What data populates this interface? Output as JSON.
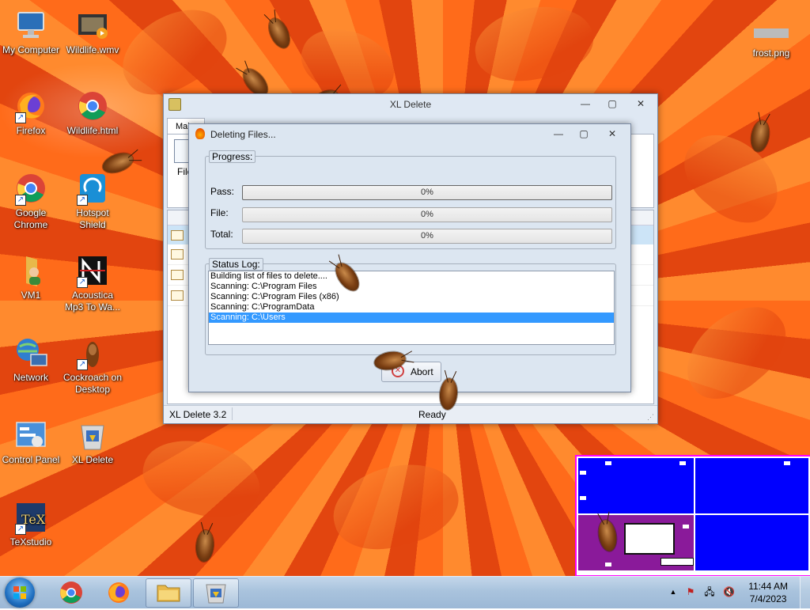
{
  "desktop": {
    "icons": [
      {
        "label": "My Computer",
        "icon": "computer-icon"
      },
      {
        "label": "Wildlife.wmv",
        "icon": "video-file-icon"
      },
      {
        "label": "Firefox",
        "icon": "firefox-icon"
      },
      {
        "label": "Wildlife.html",
        "icon": "chrome-icon"
      },
      {
        "label": "Google Chrome",
        "icon": "chrome-icon"
      },
      {
        "label": "Hotspot Shield",
        "icon": "hotspot-shield-icon"
      },
      {
        "label": "VM1",
        "icon": "user-folder-icon"
      },
      {
        "label": "Acoustica Mp3 To Wa...",
        "icon": "acoustica-icon"
      },
      {
        "label": "Network",
        "icon": "network-icon"
      },
      {
        "label": "Cockroach on Desktop",
        "icon": "cockroach-icon"
      },
      {
        "label": "Control Panel",
        "icon": "control-panel-icon"
      },
      {
        "label": "XL Delete",
        "icon": "xl-delete-icon"
      },
      {
        "label": "TeXstudio",
        "icon": "texstudio-icon"
      },
      {
        "label": "frost.png",
        "icon": "image-file-icon"
      }
    ]
  },
  "main_window": {
    "title": "XL Delete",
    "tab_label": "Mai",
    "button_label": "File",
    "status_left": "XL Delete 3.2",
    "status_right": "Ready"
  },
  "dialog": {
    "title": "Deleting Files...",
    "progress_group": "Progress:",
    "pass_label": "Pass:",
    "file_label": "File:",
    "total_label": "Total:",
    "pass_value": "0%",
    "file_value": "0%",
    "total_value": "0%",
    "progress": {
      "pass": 0,
      "file": 0,
      "total": 0
    },
    "status_group": "Status Log:",
    "log": [
      "Building list of files to delete....",
      "Scanning: C:\\Program Files",
      "Scanning: C:\\Program Files (x86)",
      "Scanning: C:\\ProgramData",
      "Scanning: C:\\Users"
    ],
    "selected_log_index": 4,
    "abort_label": "Abort"
  },
  "taskbar": {
    "time": "11:44 AM",
    "date": "7/4/2023"
  },
  "colors": {
    "selection": "#3399ff",
    "thumbnail_blue": "#0000ff",
    "thumbnail_border": "#ff00ff"
  }
}
